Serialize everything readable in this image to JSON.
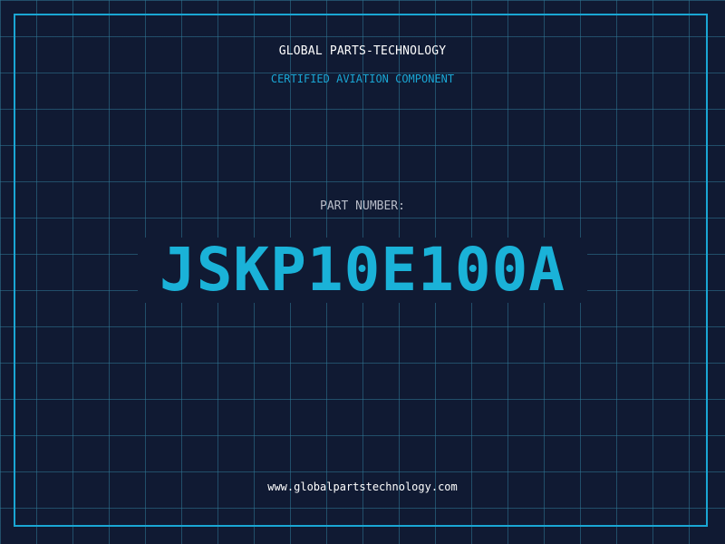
{
  "header": {
    "company_name": "GLOBAL PARTS-TECHNOLOGY",
    "certification": "CERTIFIED AVIATION COMPONENT"
  },
  "part": {
    "label": "PART NUMBER:",
    "number": "JSKP10E100A"
  },
  "footer": {
    "website": "www.globalpartstechnology.com"
  },
  "colors": {
    "background": "#101a33",
    "grid": "#30789a",
    "accent": "#1aa6d4",
    "part_number": "#1ab2d8",
    "primary_text": "#ffffff",
    "label_text": "#b7bcc8"
  }
}
